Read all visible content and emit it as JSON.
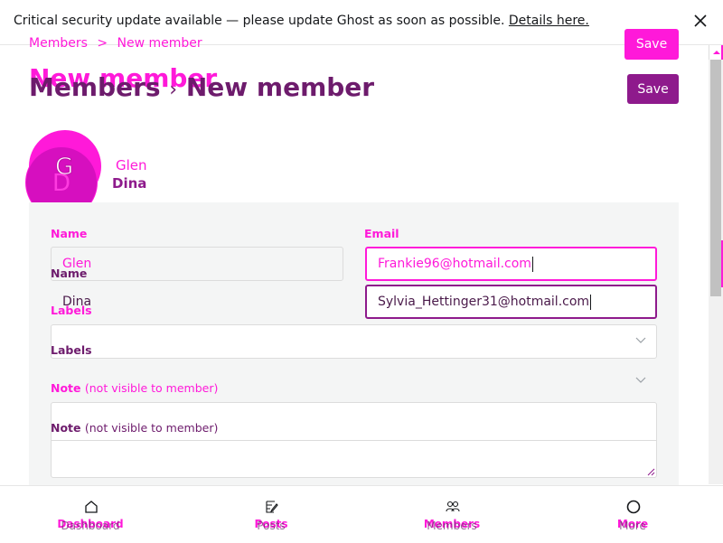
{
  "banner": {
    "message": "Critical security update available — please update Ghost as soon as possible.",
    "link": "Details here."
  },
  "breadcrumb": {
    "parent": "Members",
    "current": "New member",
    "separator": ">"
  },
  "title": {
    "ghost": "New member",
    "main_parent": "Members",
    "main_current": "New member"
  },
  "save_label": "Save",
  "member_a": {
    "initial": "G",
    "name": "Glen",
    "email": "Frankie96@hotmail.com"
  },
  "member_b": {
    "initial": "D",
    "name": "Dina",
    "email": "Sylvia_Hettinger31@hotmail.com"
  },
  "form": {
    "name_label": "Name",
    "email_label": "Email",
    "labels_label": "Labels",
    "note_label": "Note",
    "note_hint": "(not visible to member)"
  },
  "nav": {
    "dashboard": "Dashboard",
    "posts": "Posts",
    "members": "Members",
    "more": "More"
  },
  "colors": {
    "accent": "#ff19d9",
    "brand": "#8e1a8c",
    "panel": "#f4f5f5"
  }
}
